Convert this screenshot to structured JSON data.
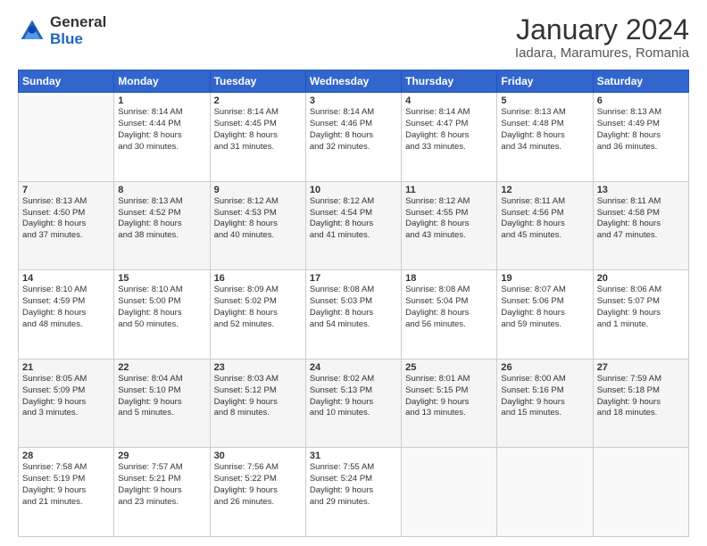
{
  "logo": {
    "general": "General",
    "blue": "Blue"
  },
  "title": "January 2024",
  "subtitle": "Iadara, Maramures, Romania",
  "weekdays": [
    "Sunday",
    "Monday",
    "Tuesday",
    "Wednesday",
    "Thursday",
    "Friday",
    "Saturday"
  ],
  "weeks": [
    [
      {
        "day": "",
        "info": ""
      },
      {
        "day": "1",
        "info": "Sunrise: 8:14 AM\nSunset: 4:44 PM\nDaylight: 8 hours\nand 30 minutes."
      },
      {
        "day": "2",
        "info": "Sunrise: 8:14 AM\nSunset: 4:45 PM\nDaylight: 8 hours\nand 31 minutes."
      },
      {
        "day": "3",
        "info": "Sunrise: 8:14 AM\nSunset: 4:46 PM\nDaylight: 8 hours\nand 32 minutes."
      },
      {
        "day": "4",
        "info": "Sunrise: 8:14 AM\nSunset: 4:47 PM\nDaylight: 8 hours\nand 33 minutes."
      },
      {
        "day": "5",
        "info": "Sunrise: 8:13 AM\nSunset: 4:48 PM\nDaylight: 8 hours\nand 34 minutes."
      },
      {
        "day": "6",
        "info": "Sunrise: 8:13 AM\nSunset: 4:49 PM\nDaylight: 8 hours\nand 36 minutes."
      }
    ],
    [
      {
        "day": "7",
        "info": "Sunrise: 8:13 AM\nSunset: 4:50 PM\nDaylight: 8 hours\nand 37 minutes."
      },
      {
        "day": "8",
        "info": "Sunrise: 8:13 AM\nSunset: 4:52 PM\nDaylight: 8 hours\nand 38 minutes."
      },
      {
        "day": "9",
        "info": "Sunrise: 8:12 AM\nSunset: 4:53 PM\nDaylight: 8 hours\nand 40 minutes."
      },
      {
        "day": "10",
        "info": "Sunrise: 8:12 AM\nSunset: 4:54 PM\nDaylight: 8 hours\nand 41 minutes."
      },
      {
        "day": "11",
        "info": "Sunrise: 8:12 AM\nSunset: 4:55 PM\nDaylight: 8 hours\nand 43 minutes."
      },
      {
        "day": "12",
        "info": "Sunrise: 8:11 AM\nSunset: 4:56 PM\nDaylight: 8 hours\nand 45 minutes."
      },
      {
        "day": "13",
        "info": "Sunrise: 8:11 AM\nSunset: 4:58 PM\nDaylight: 8 hours\nand 47 minutes."
      }
    ],
    [
      {
        "day": "14",
        "info": "Sunrise: 8:10 AM\nSunset: 4:59 PM\nDaylight: 8 hours\nand 48 minutes."
      },
      {
        "day": "15",
        "info": "Sunrise: 8:10 AM\nSunset: 5:00 PM\nDaylight: 8 hours\nand 50 minutes."
      },
      {
        "day": "16",
        "info": "Sunrise: 8:09 AM\nSunset: 5:02 PM\nDaylight: 8 hours\nand 52 minutes."
      },
      {
        "day": "17",
        "info": "Sunrise: 8:08 AM\nSunset: 5:03 PM\nDaylight: 8 hours\nand 54 minutes."
      },
      {
        "day": "18",
        "info": "Sunrise: 8:08 AM\nSunset: 5:04 PM\nDaylight: 8 hours\nand 56 minutes."
      },
      {
        "day": "19",
        "info": "Sunrise: 8:07 AM\nSunset: 5:06 PM\nDaylight: 8 hours\nand 59 minutes."
      },
      {
        "day": "20",
        "info": "Sunrise: 8:06 AM\nSunset: 5:07 PM\nDaylight: 9 hours\nand 1 minute."
      }
    ],
    [
      {
        "day": "21",
        "info": "Sunrise: 8:05 AM\nSunset: 5:09 PM\nDaylight: 9 hours\nand 3 minutes."
      },
      {
        "day": "22",
        "info": "Sunrise: 8:04 AM\nSunset: 5:10 PM\nDaylight: 9 hours\nand 5 minutes."
      },
      {
        "day": "23",
        "info": "Sunrise: 8:03 AM\nSunset: 5:12 PM\nDaylight: 9 hours\nand 8 minutes."
      },
      {
        "day": "24",
        "info": "Sunrise: 8:02 AM\nSunset: 5:13 PM\nDaylight: 9 hours\nand 10 minutes."
      },
      {
        "day": "25",
        "info": "Sunrise: 8:01 AM\nSunset: 5:15 PM\nDaylight: 9 hours\nand 13 minutes."
      },
      {
        "day": "26",
        "info": "Sunrise: 8:00 AM\nSunset: 5:16 PM\nDaylight: 9 hours\nand 15 minutes."
      },
      {
        "day": "27",
        "info": "Sunrise: 7:59 AM\nSunset: 5:18 PM\nDaylight: 9 hours\nand 18 minutes."
      }
    ],
    [
      {
        "day": "28",
        "info": "Sunrise: 7:58 AM\nSunset: 5:19 PM\nDaylight: 9 hours\nand 21 minutes."
      },
      {
        "day": "29",
        "info": "Sunrise: 7:57 AM\nSunset: 5:21 PM\nDaylight: 9 hours\nand 23 minutes."
      },
      {
        "day": "30",
        "info": "Sunrise: 7:56 AM\nSunset: 5:22 PM\nDaylight: 9 hours\nand 26 minutes."
      },
      {
        "day": "31",
        "info": "Sunrise: 7:55 AM\nSunset: 5:24 PM\nDaylight: 9 hours\nand 29 minutes."
      },
      {
        "day": "",
        "info": ""
      },
      {
        "day": "",
        "info": ""
      },
      {
        "day": "",
        "info": ""
      }
    ]
  ]
}
